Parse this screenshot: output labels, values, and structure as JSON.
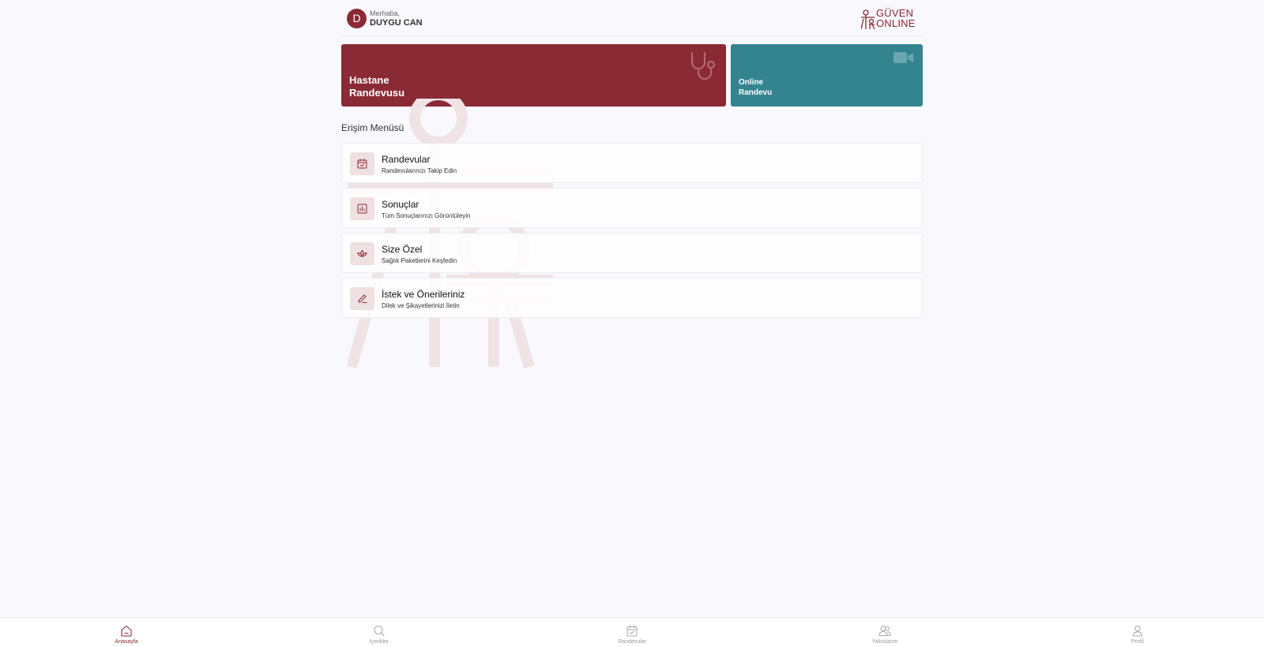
{
  "header": {
    "avatar_initial": "D",
    "greeting": "Merhaba,",
    "user_name": "DUYGU CAN",
    "logo_line1": "GÜVEN",
    "logo_line2": "ONLINE"
  },
  "cards": {
    "hospital": {
      "line1": "Hastane",
      "line2": "Randevusu",
      "icon": "stethoscope-icon",
      "color": "#8a2a35"
    },
    "online": {
      "line1": "Online",
      "line2": "Randevu",
      "icon": "video-camera-icon",
      "color": "#33848f"
    }
  },
  "menu": {
    "title": "Erişim Menüsü",
    "items": [
      {
        "title": "Randevular",
        "subtitle": "Randevularınızı Takip Edin",
        "icon": "calendar-check-icon"
      },
      {
        "title": "Sonuçlar",
        "subtitle": "Tüm Sonuçlarınızı Görüntüleyin",
        "icon": "chart-icon"
      },
      {
        "title": "Size Özel",
        "subtitle": "Sağlık Paketlerini Keşfedin",
        "icon": "lotus-icon"
      },
      {
        "title": "İstek ve Önerileriniz",
        "subtitle": "Dilek ve Şikayetlerinizi İletin",
        "icon": "pencil-icon"
      }
    ]
  },
  "bottom_nav": [
    {
      "label": "Anasayfa",
      "icon": "home-icon",
      "active": true
    },
    {
      "label": "İçerikler",
      "icon": "search-icon",
      "active": false
    },
    {
      "label": "Randevular",
      "icon": "calendar-icon",
      "active": false
    },
    {
      "label": "Yakınlarım",
      "icon": "users-icon",
      "active": false
    },
    {
      "label": "Profil",
      "icon": "user-icon",
      "active": false
    }
  ],
  "colors": {
    "brand": "#8a2a35",
    "teal": "#33848f",
    "background": "#f8f8fd"
  }
}
